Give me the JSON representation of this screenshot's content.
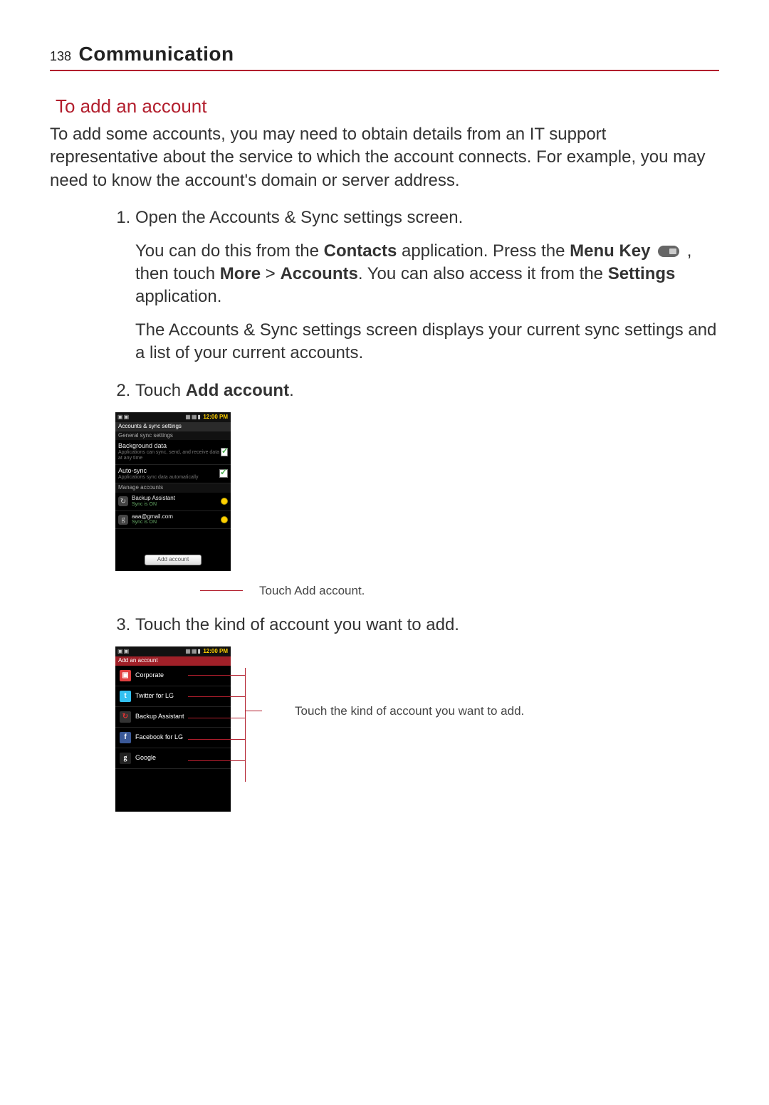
{
  "page": {
    "number": "138",
    "chapter": "Communication"
  },
  "section": {
    "heading": "To add an account",
    "intro": "To add some accounts, you may need to obtain details from an IT support representative about the service to which the account connects. For example, you may need to know the account's domain or server address."
  },
  "steps": {
    "s1": {
      "text": "Open the Accounts & Sync settings screen.",
      "p1_a": "You can do this from the ",
      "p1_b": "Contacts",
      "p1_c": " application. Press the ",
      "p1_d": "Menu Key",
      "p1_e": " , then touch ",
      "p1_f": "More",
      "p1_g": " > ",
      "p1_h": "Accounts",
      "p1_i": ". You can also access it from the ",
      "p1_j": "Settings",
      "p1_k": " application.",
      "p2": "The Accounts & Sync settings screen displays your current sync settings and a list of your current accounts."
    },
    "s2": {
      "text_a": "Touch ",
      "text_b": "Add account",
      "text_c": "."
    },
    "s3": {
      "text": "Touch the kind of account you want to add."
    }
  },
  "callouts": {
    "c1": "Touch Add account.",
    "c2": "Touch the kind of account you want to add."
  },
  "phone_common": {
    "time": "12:00 PM"
  },
  "phone1": {
    "screen_title": "Accounts & sync settings",
    "sub1": "General sync settings",
    "bg_title": "Background data",
    "bg_sub": "Applications can sync, send, and receive data at any time",
    "auto_title": "Auto-sync",
    "auto_sub": "Applications sync data automatically",
    "sub2": "Manage accounts",
    "acc1_title": "Backup Assistant",
    "acc1_sub": "Sync is ON",
    "acc2_title": "aaa@gmail.com",
    "acc2_sub": "Sync is ON",
    "add_btn": "Add account"
  },
  "phone2": {
    "screen_title": "Add an account",
    "t1": "Corporate",
    "t2": "Twitter for LG",
    "t3": "Backup Assistant",
    "t4": "Facebook for LG",
    "t5": "Google"
  }
}
